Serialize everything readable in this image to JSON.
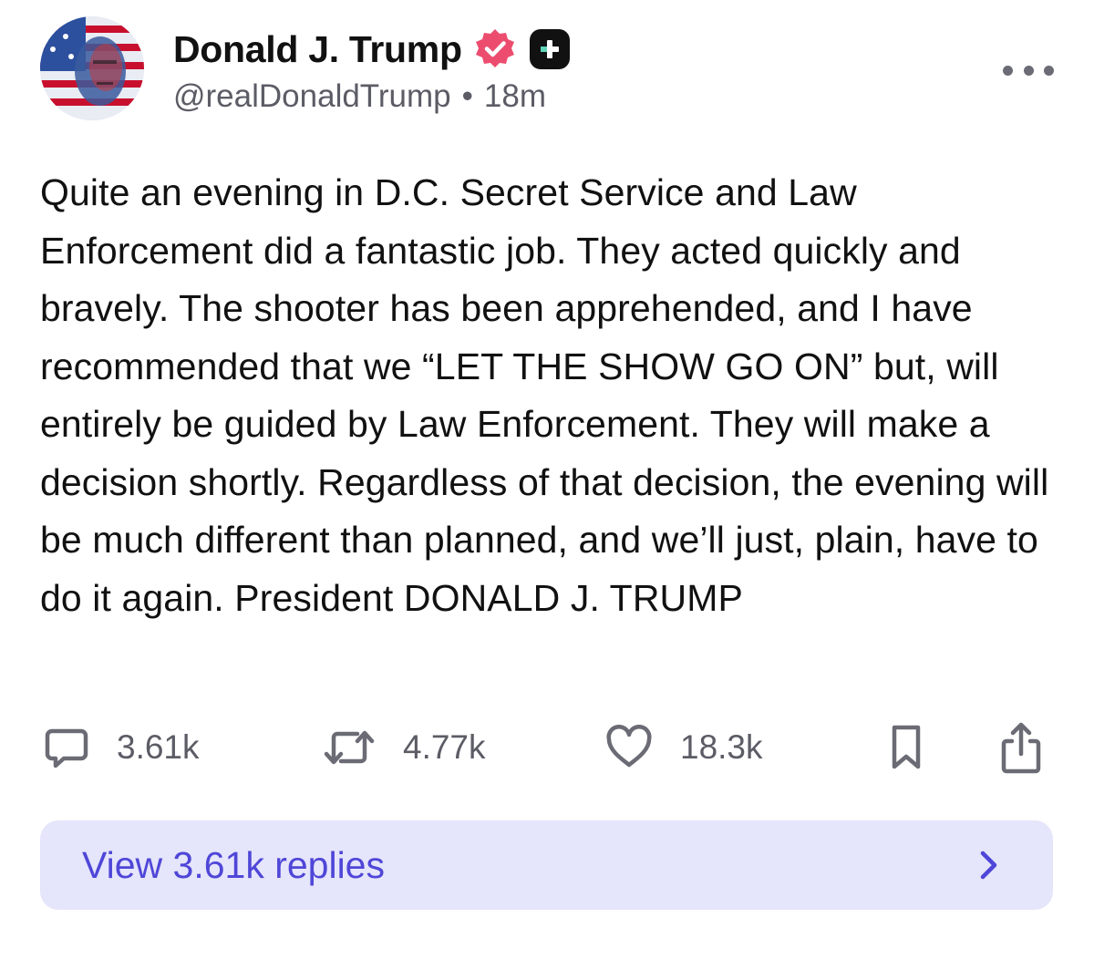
{
  "post": {
    "author": {
      "display_name": "Donald J. Trump",
      "handle": "@realDonaldTrump",
      "time_ago": "18m",
      "separator": "•",
      "verified_icon": "verified-badge-icon",
      "plus_icon": "plus-badge-icon"
    },
    "text": "Quite an evening in D.C. Secret Service and Law Enforcement did a fantastic job. They acted quickly and bravely. The shooter has been apprehended, and I have recommended that we “LET THE SHOW GO ON” but, will entirely be guided by Law Enforcement. They will make a decision shortly. Regardless of that decision, the evening will be much different than planned, and we’ll just, plain, have to do it again. President DONALD J. TRUMP",
    "stats": {
      "replies": "3.61k",
      "reposts": "4.77k",
      "likes": "18.3k"
    }
  },
  "replies_bar": {
    "label": "View 3.61k replies"
  },
  "colors": {
    "accent": "#4f46d8",
    "verified": "#ec4d6f",
    "replies_bg": "#e5e5fb",
    "muted": "#5c5c66"
  }
}
